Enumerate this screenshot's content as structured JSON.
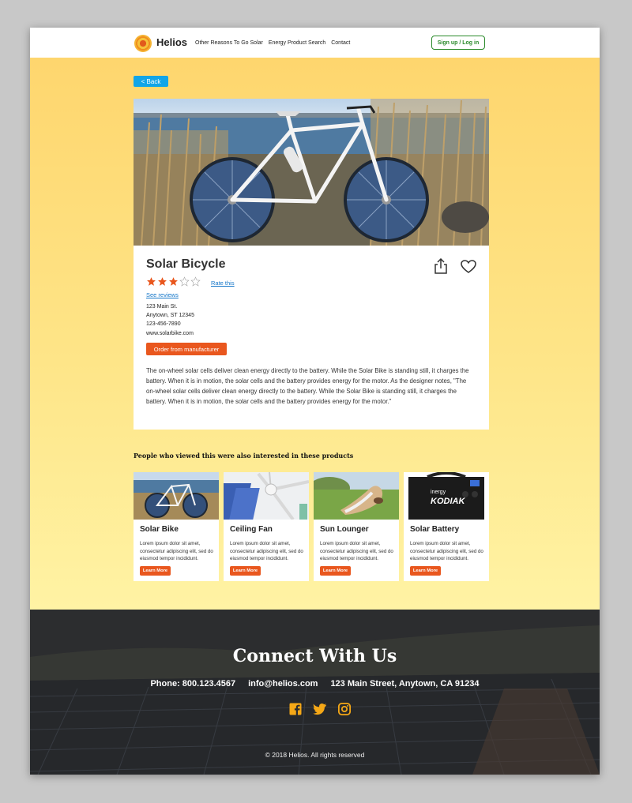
{
  "header": {
    "brand": "Helios",
    "nav": [
      "Other Reasons To Go Solar",
      "Energy Product Search",
      "Contact"
    ],
    "signup_label": "Sign up / Log in"
  },
  "back_label": "< Back",
  "product": {
    "title": "Solar Bicycle",
    "rating": 3,
    "rating_max": 5,
    "rate_label": "Rate this",
    "see_reviews_label": "See reviews",
    "address_line1": "123 Main St.",
    "address_line2": "Anytown, ST 12345",
    "phone": "123-456-7890",
    "website": "www.solarbike.com",
    "order_label": "Order from manufacturer",
    "description": "The on-wheel solar cells deliver clean energy directly to the battery. While the Solar Bike is standing still, it charges the battery. When it is in motion, the solar cells and the battery provides energy for the motor. As the designer notes, \"The on-wheel solar cells deliver clean energy directly to the battery. While the Solar Bike is standing still, it charges the battery. When it is in motion, the solar cells and the battery provides energy for the motor.\""
  },
  "related": {
    "title": "People who viewed this were also interested in these products",
    "items": [
      {
        "name": "Solar Bike",
        "desc": "Lorem ipsum dolor sit amet, consectetur adipiscing elit, sed do eiusmod tempor incididunt.",
        "button": "Learn More"
      },
      {
        "name": "Ceiling Fan",
        "desc": "Lorem ipsum dolor sit amet, consectetur adipiscing elit, sed do eiusmod tempor incididunt.",
        "button": "Learn More"
      },
      {
        "name": "Sun Lounger",
        "desc": "Lorem ipsum dolor sit amet, consectetur adipiscing elit, sed do eiusmod tempor incididunt.",
        "button": "Learn More"
      },
      {
        "name": "Solar Battery",
        "desc": "Lorem ipsum dolor sit amet, consectetur adipiscing elit, sed do eiusmod tempor incididunt.",
        "button": "Learn More"
      }
    ],
    "battery_brand": "inergy",
    "battery_model": "KODIAK"
  },
  "footer": {
    "title": "Connect With Us",
    "phone": "Phone: 800.123.4567",
    "email": "info@helios.com",
    "address": "123 Main Street, Anytown, CA 91234",
    "social": [
      "facebook-icon",
      "twitter-icon",
      "instagram-icon"
    ],
    "copyright": "© 2018 Helios. All rights reserved"
  },
  "colors": {
    "accent_orange": "#e9571e",
    "link_blue": "#1677c9",
    "back_blue": "#11a5e8",
    "signup_green": "#2a8a2a",
    "social_yellow": "#f5a817",
    "star_orange": "#e9571e"
  }
}
